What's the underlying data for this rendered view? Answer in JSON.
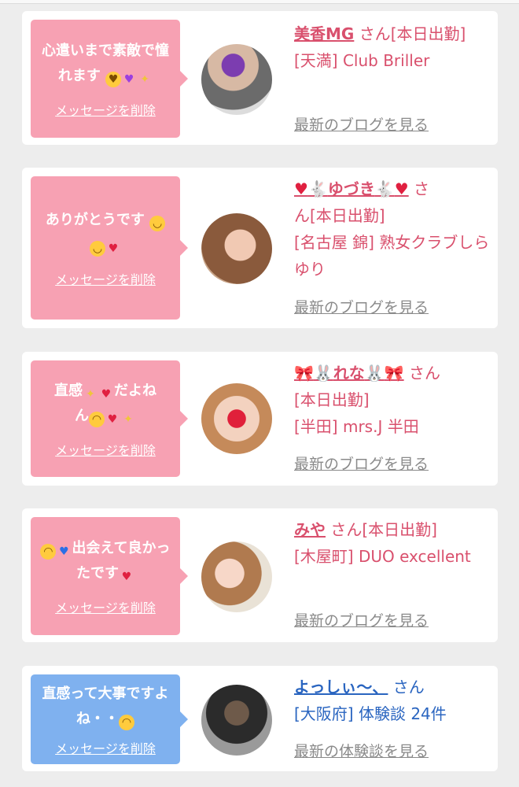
{
  "cards": [
    {
      "message_parts": [
        "心遣いまで素敵で憧れます",
        "",
        "",
        ""
      ],
      "delete_label": "メッセージを削除",
      "username": "美香MG",
      "honorific": "さん",
      "status": "[本日出勤]",
      "location": "[天満] Club Briller",
      "link_label": "最新のブログを見る"
    },
    {
      "message_parts": [
        "ありがとうです"
      ],
      "delete_label": "メッセージを削除",
      "username": "ゆづき",
      "honorific": "さ",
      "status": "ん[本日出勤]",
      "location": "[名古屋 錦] 熟女クラブしらゆり",
      "link_label": "最新のブログを見る"
    },
    {
      "message_parts": [
        "直感",
        "だよね",
        "ん"
      ],
      "delete_label": "メッセージを削除",
      "username": "れな",
      "honorific": "さん",
      "status": "[本日出勤]",
      "location": "[半田] mrs.J 半田",
      "link_label": "最新のブログを見る"
    },
    {
      "message_parts": [
        "出会えて良かったです"
      ],
      "delete_label": "メッセージを削除",
      "username": "みや",
      "honorific": "さん[本日出勤]",
      "status": "",
      "location": "[木屋町] DUO excellent",
      "link_label": "最新のブログを見る"
    },
    {
      "message_parts": [
        "直感って大事ですよね・・"
      ],
      "delete_label": "メッセージを削除",
      "username": "よっしぃ〜、",
      "honorific": "さん",
      "status": "",
      "location": "[大阪府] 体験談 24件",
      "link_label": "最新の体験談を見る"
    }
  ],
  "colors": {
    "pink_bubble": "#f7a1b3",
    "blue_bubble": "#7fb1ef",
    "pink_text": "#d9506d",
    "blue_text": "#2a65c0",
    "link_gray": "#8a8a8a"
  },
  "icons": [
    "heart-eyes-emoji",
    "purple-heart-icon",
    "sparkles-icon",
    "smile-emoji",
    "red-heart-icon",
    "rabbit-icon",
    "ribbon-icon",
    "winking-face-emoji",
    "two-hearts-icon",
    "weary-face-emoji",
    "blue-heart-icon"
  ]
}
